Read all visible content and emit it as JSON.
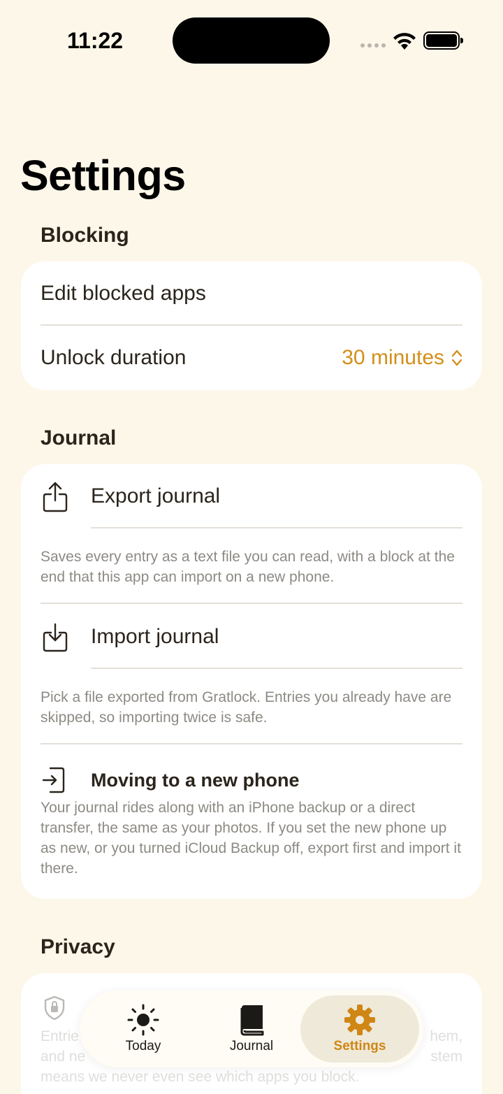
{
  "status": {
    "time": "11:22"
  },
  "page": {
    "title": "Settings"
  },
  "blocking": {
    "header": "Blocking",
    "edit_label": "Edit blocked apps",
    "unlock_label": "Unlock duration",
    "unlock_value": "30 minutes"
  },
  "journal": {
    "header": "Journal",
    "export_label": "Export journal",
    "export_desc": "Saves every entry as a text file you can read, with a block at the end that this app can import on a new phone.",
    "import_label": "Import journal",
    "import_desc": "Pick a file exported from Gratlock. Entries you already have are skipped, so importing twice is safe.",
    "moving_label": "Moving to a new phone",
    "moving_desc": "Your journal rides along with an iPhone backup or a direct transfer, the same as your photos. If you set the new phone up as new, or you turned iCloud Backup off, export first and import it there."
  },
  "privacy": {
    "header": "Privacy",
    "line1_start": "Entrie",
    "line1_end": "hem,",
    "line2_start": "and ne",
    "line2_end": "stem",
    "line3": "means we never even see which apps you block."
  },
  "tabs": [
    {
      "label": "Today",
      "icon": "sun-icon"
    },
    {
      "label": "Journal",
      "icon": "book-icon"
    },
    {
      "label": "Settings",
      "icon": "gear-icon"
    }
  ],
  "colors": {
    "accent": "#d38f1a",
    "background": "#fdf7e9",
    "card": "#ffffff"
  }
}
